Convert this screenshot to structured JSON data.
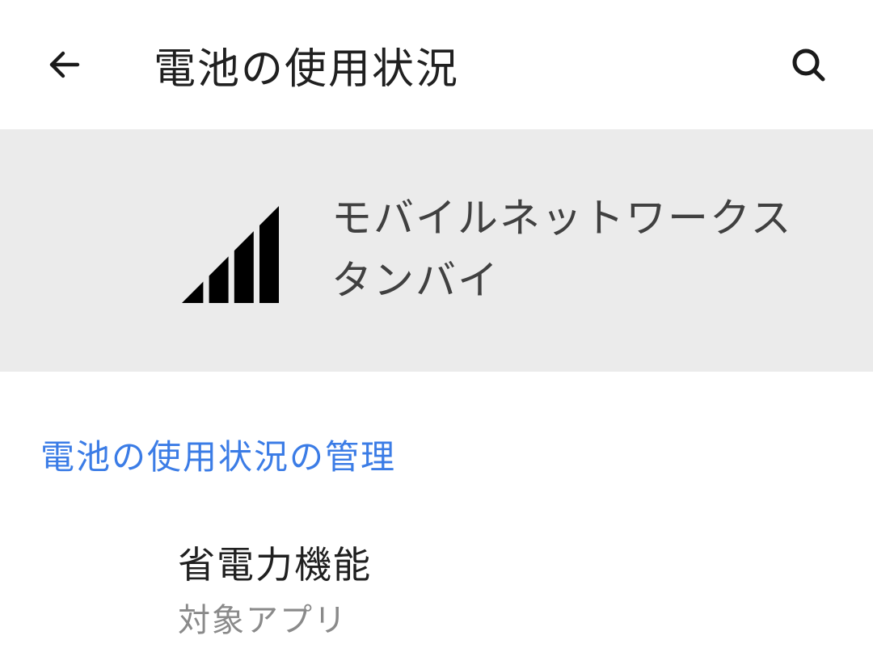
{
  "header": {
    "title": "電池の使用状況"
  },
  "app_card": {
    "name": "モバイルネットワークスタンバイ"
  },
  "section": {
    "title": "電池の使用状況の管理"
  },
  "items": [
    {
      "title": "省電力機能",
      "subtitle": "対象アプリ"
    }
  ]
}
